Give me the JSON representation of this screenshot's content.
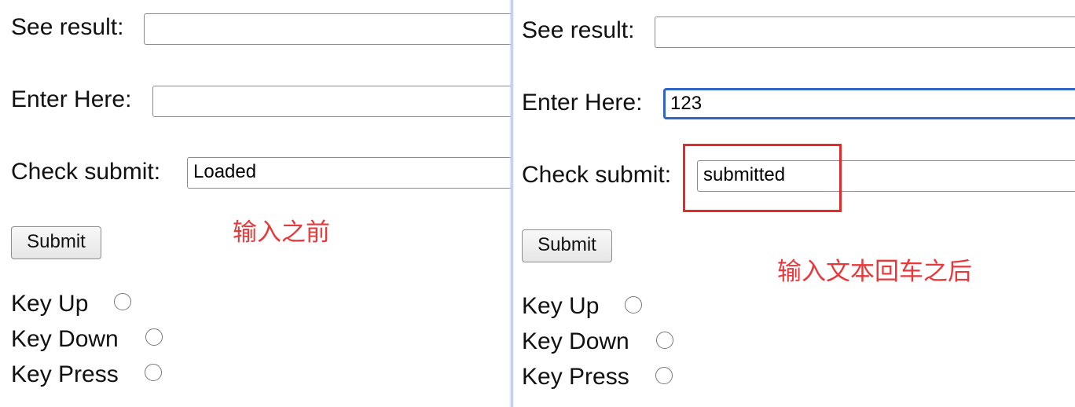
{
  "left": {
    "see_result": {
      "label": "See result:",
      "value": ""
    },
    "enter_here": {
      "label": "Enter Here:",
      "value": ""
    },
    "check_submit": {
      "label": "Check submit:",
      "value": "Loaded"
    },
    "submit_label": "Submit",
    "radios": [
      {
        "label": "Key Up",
        "checked": false
      },
      {
        "label": "Key Down",
        "checked": false
      },
      {
        "label": "Key Press",
        "checked": false
      }
    ],
    "annotation": "输入之前"
  },
  "right": {
    "see_result": {
      "label": "See result:",
      "value": ""
    },
    "enter_here": {
      "label": "Enter Here:",
      "value": "123"
    },
    "check_submit": {
      "label": "Check submit:",
      "value": "submitted"
    },
    "submit_label": "Submit",
    "radios": [
      {
        "label": "Key Up",
        "checked": false
      },
      {
        "label": "Key Down",
        "checked": false
      },
      {
        "label": "Key Press",
        "checked": false
      }
    ],
    "annotation": "输入文本回车之后"
  },
  "colors": {
    "focus_border": "#2f65c6",
    "annotation": "#e5393b"
  }
}
